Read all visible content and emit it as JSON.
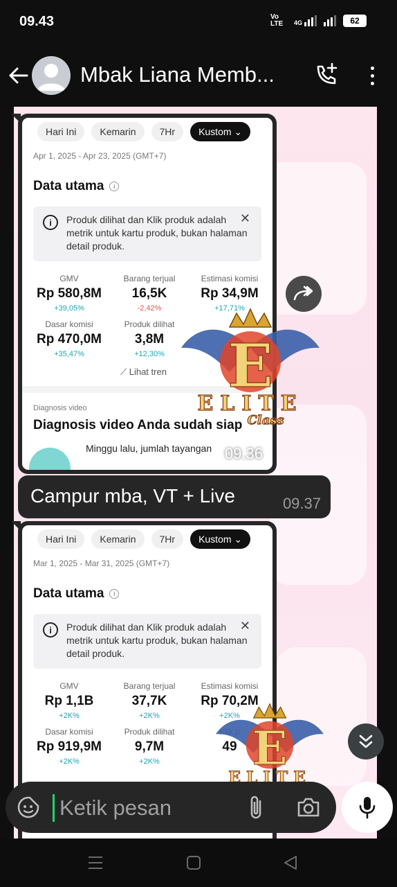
{
  "status_bar": {
    "time": "09.43",
    "network_label": "Vo LTE",
    "network_gen": "4G",
    "battery": "62"
  },
  "header": {
    "title": "Mbak Liana Memb..."
  },
  "messages": [
    {
      "type": "image",
      "time": "09.36",
      "chips": [
        "Hari Ini",
        "Kemarin",
        "7Hr",
        "Kustom"
      ],
      "date_range": "Apr 1, 2025 - Apr 23, 2025 (GMT+7)",
      "section_title": "Data utama",
      "notice": "Produk dilihat dan Klik produk adalah metrik untuk kartu produk, bukan halaman detail produk.",
      "metrics": [
        {
          "label": "GMV",
          "value": "Rp 580,8M",
          "change": "+39,05%"
        },
        {
          "label": "Barang terjual",
          "value": "16,5K",
          "change": "-2,42%"
        },
        {
          "label": "Estimasi komisi",
          "value": "Rp 34,9M",
          "change": "+17,71%"
        },
        {
          "label": "Dasar komisi",
          "value": "Rp 470,0M",
          "change": "+35,47%"
        },
        {
          "label": "Produk dilihat",
          "value": "3,8M",
          "change": "+12,30%"
        }
      ],
      "trend_link": "Lihat tren",
      "diag_label": "Diagnosis video",
      "diag_title": "Diagnosis video Anda sudah siap",
      "diag_text": "Minggu lalu, jumlah tayangan"
    },
    {
      "type": "text",
      "text": "Campur mba, VT + Live",
      "time": "09.37"
    },
    {
      "type": "image",
      "chips": [
        "Hari Ini",
        "Kemarin",
        "7Hr",
        "Kustom"
      ],
      "date_range": "Mar 1, 2025 - Mar 31, 2025 (GMT+7)",
      "section_title": "Data utama",
      "notice": "Produk dilihat dan Klik produk adalah metrik untuk kartu produk, bukan halaman detail produk.",
      "metrics": [
        {
          "label": "GMV",
          "value": "Rp 1,1B",
          "change": "+2K%"
        },
        {
          "label": "Barang terjual",
          "value": "37,7K",
          "change": "+2K%"
        },
        {
          "label": "Estimasi komisi",
          "value": "Rp 70,2M",
          "change": "+2K%"
        },
        {
          "label": "Dasar komisi",
          "value": "Rp 919,9M",
          "change": "+2K%"
        },
        {
          "label": "Produk dilihat",
          "value": "9,7M",
          "change": "+2K%"
        },
        {
          "label": "Klik p",
          "value": "49",
          "change": ""
        }
      ]
    }
  ],
  "watermark": {
    "letter": "E",
    "word": "ELITE",
    "subword": "Class"
  },
  "composer": {
    "placeholder": "Ketik pesan"
  },
  "icons": {
    "back": "arrow-left-icon",
    "call": "add-call-icon",
    "menu": "more-vert-icon",
    "forward": "forward-icon",
    "scroll": "double-chevron-down-icon",
    "emoji": "sticker-icon",
    "attach": "paperclip-icon",
    "camera": "camera-icon",
    "mic": "mic-icon"
  }
}
